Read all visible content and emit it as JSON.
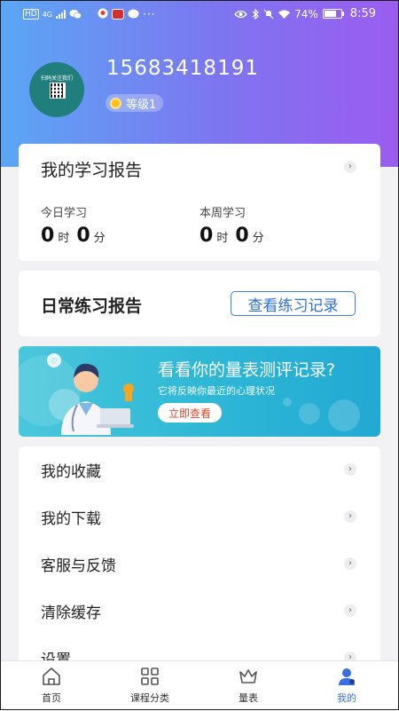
{
  "status_bar": {
    "network": "HD",
    "network_type": "4G",
    "battery": "74%",
    "time": "8:59",
    "icons": [
      "signal-icon",
      "wechat-icon",
      "maps-icon",
      "news-icon",
      "message-icon",
      "more-icon",
      "eye-icon",
      "bluetooth-icon",
      "mute-icon",
      "wifi-icon",
      "battery-icon"
    ]
  },
  "profile": {
    "phone": "15683418191",
    "level": "等级1",
    "avatar_text": "扫码关注我们"
  },
  "study_report": {
    "title": "我的学习报告",
    "today_label": "今日学习",
    "week_label": "本周学习",
    "today_hours": "0",
    "today_minutes": "0",
    "week_hours": "0",
    "week_minutes": "0",
    "hour_unit": "时",
    "minute_unit": "分"
  },
  "practice_report": {
    "title": "日常练习报告",
    "button": "查看练习记录"
  },
  "banner": {
    "title": "看看你的量表测评记录?",
    "subtitle": "它将反映你最近的心理状况",
    "button": "立即查看"
  },
  "menu": {
    "items": [
      {
        "label": "我的收藏"
      },
      {
        "label": "我的下载"
      },
      {
        "label": "客服与反馈"
      },
      {
        "label": "清除缓存"
      },
      {
        "label": "设置"
      }
    ]
  },
  "tabs": [
    {
      "label": "首页",
      "icon": "home-icon"
    },
    {
      "label": "课程分类",
      "icon": "category-icon"
    },
    {
      "label": "量表",
      "icon": "crown-icon"
    },
    {
      "label": "我的",
      "icon": "user-icon",
      "active": true
    }
  ],
  "colors": {
    "accent": "#3a6fe2",
    "hero_start": "#5aa7f5",
    "hero_end": "#9b5cf0",
    "banner": "#2fb8d6"
  }
}
